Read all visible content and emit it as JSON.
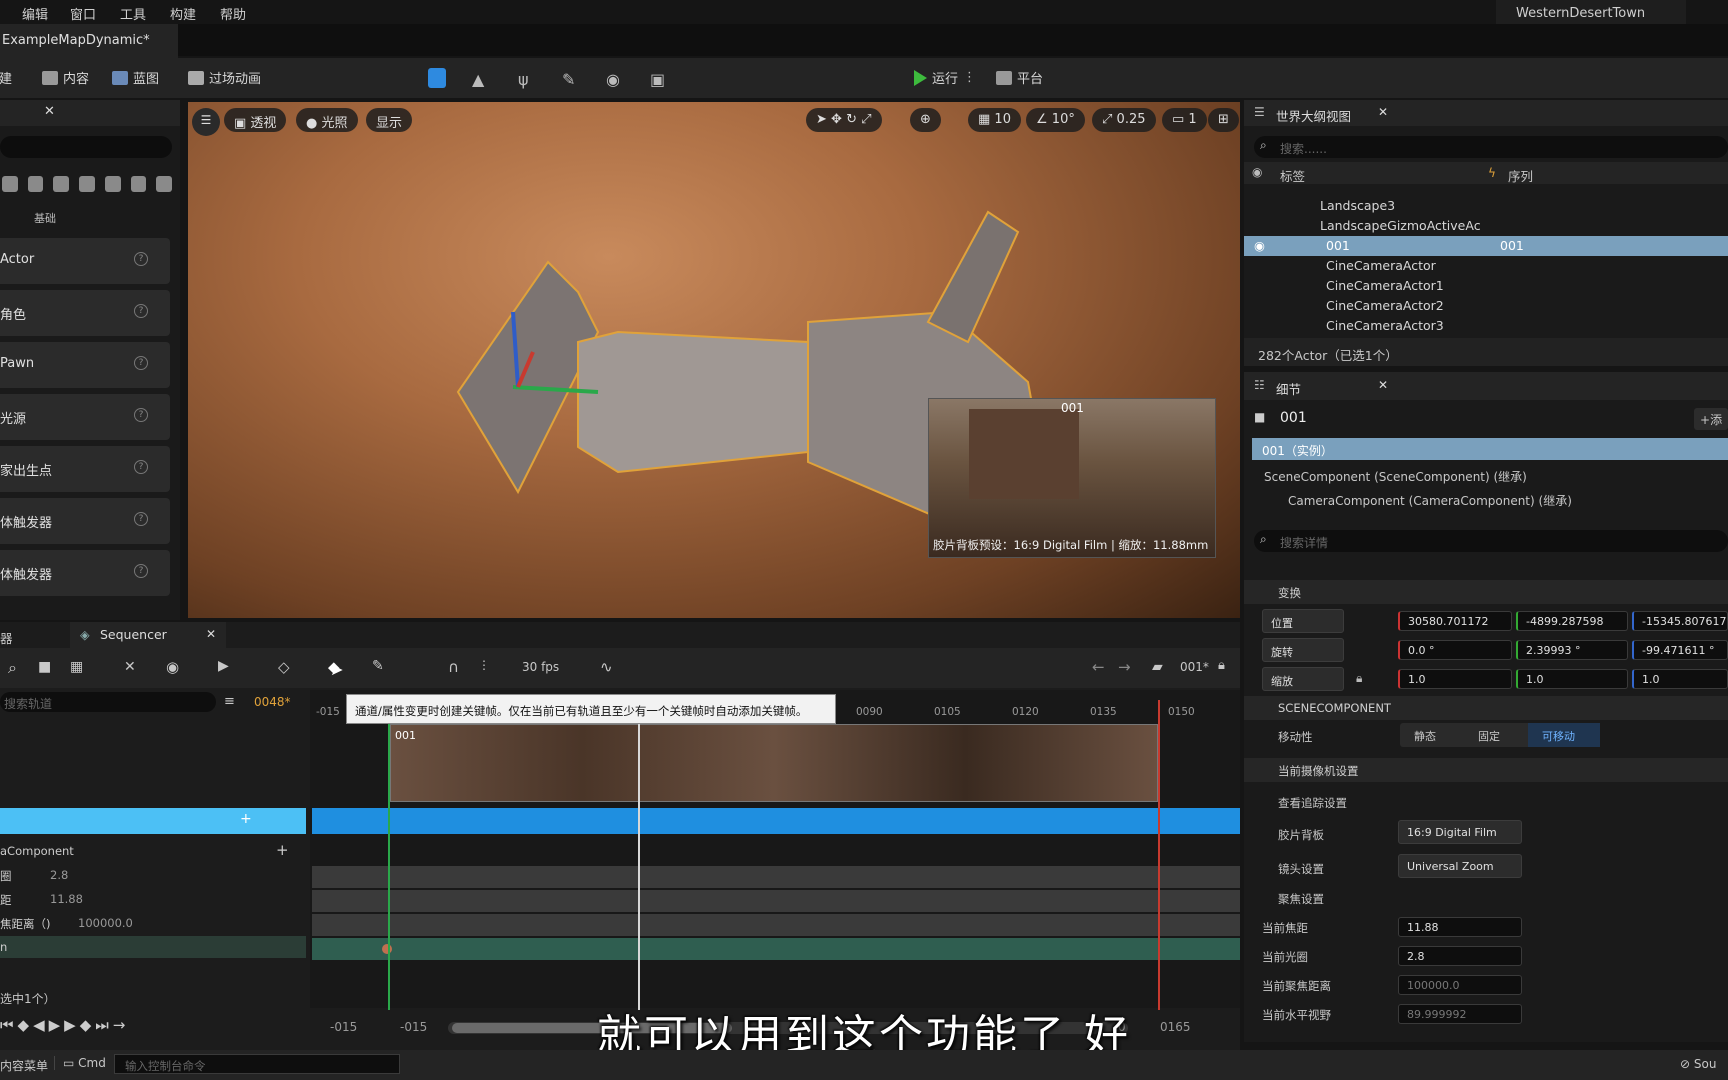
{
  "menubar": {
    "items": [
      "编辑",
      "窗口",
      "工具",
      "构建",
      "帮助"
    ],
    "project": "WesternDesertTown"
  },
  "map_tab": "ExampleMapDynamic*",
  "toolbar": {
    "create": "创建",
    "content": "内容",
    "blueprint": "蓝图",
    "cinematics": "过场动画",
    "run": "运行",
    "platform": "平台"
  },
  "place_panel": {
    "category": "基础",
    "items": [
      "Actor",
      "角色",
      "Pawn",
      "光源",
      "家出生点",
      "体触发器",
      "体触发器"
    ]
  },
  "viewport": {
    "perspective": "透视",
    "lit": "光照",
    "show": "显示",
    "grid": "10",
    "angle": "10°",
    "scale": "0.25",
    "cam": "1",
    "pip_label": "001",
    "pip_info": "胶片背板预设：16:9 Digital Film | 缩放：11.88mm"
  },
  "outliner": {
    "title": "世界大纲视图",
    "search_placeholder": "搜索......",
    "col_label": "标签",
    "col_seq": "序列",
    "rows": [
      {
        "name": "Landscape3",
        "seq": ""
      },
      {
        "name": "LandscapeGizmoActiveAc",
        "seq": ""
      },
      {
        "name": "001",
        "seq": "001"
      },
      {
        "name": "CineCameraActor",
        "seq": ""
      },
      {
        "name": "CineCameraActor1",
        "seq": ""
      },
      {
        "name": "CineCameraActor2",
        "seq": ""
      },
      {
        "name": "CineCameraActor3",
        "seq": ""
      }
    ],
    "count": "282个Actor（已选1个）"
  },
  "details": {
    "title": "细节",
    "actor": "001",
    "add": "添",
    "instance": "001（实例）",
    "scene_component": "SceneComponent (SceneComponent) (继承)",
    "camera_component": "CameraComponent (CameraComponent) (继承)",
    "search_placeholder": "搜索详情",
    "transform": "变换",
    "location_label": "位置",
    "location": [
      "30580.701172",
      "-4899.287598",
      "-15345.807617"
    ],
    "rotation_label": "旋转",
    "rotation": [
      "0.0 °",
      "2.39993 °",
      "-99.471611 °"
    ],
    "scale_label": "缩放",
    "scale": [
      "1.0",
      "1.0",
      "1.0"
    ],
    "scenecomponent": "SCENECOMPONENT",
    "mobility_label": "移动性",
    "mobility": [
      "静态",
      "固定",
      "可移动"
    ],
    "camera_settings": "当前摄像机设置",
    "lookat": "查看追踪设置",
    "filmback_label": "胶片背板",
    "filmback": "16:9 Digital Film",
    "lens_label": "镜头设置",
    "lens": "Universal Zoom",
    "focus_label": "聚焦设置",
    "focal_label": "当前焦距",
    "focal": "11.88",
    "aperture_label": "当前光圈",
    "aperture": "2.8",
    "focus_dist_label": "当前聚焦距离",
    "focus_dist": "100000.0",
    "hfov_label": "当前水平视野",
    "hfov": "89.999992"
  },
  "sequencer": {
    "prev_tab": "器",
    "tab": "Sequencer",
    "fps": "30 fps",
    "seq_name": "001*",
    "search_placeholder": "搜索轨道",
    "frame": "0048*",
    "ticks": [
      "-015",
      "0090",
      "0105",
      "0120",
      "0135",
      "0150"
    ],
    "track_component": "aComponent",
    "tracks": [
      {
        "label": "圈",
        "value": "2.8"
      },
      {
        "label": "距",
        "value": "11.88"
      },
      {
        "label": "焦距离（)",
        "value": "100000.0"
      },
      {
        "label": "n",
        "value": ""
      }
    ],
    "clip_label": "001",
    "selected": "选中1个）",
    "range_start": "-015",
    "range_start2": "-015",
    "range_end": "0165",
    "range_mid": "0",
    "tooltip": "通道/属性变更时创建关键帧。仅在当前已有轨道且至少有一个关键帧时自动添加关键帧。"
  },
  "subtitle": "就可以用到这个功能了 好",
  "statusbar": {
    "menu": "内容菜单",
    "cmd": "Cmd",
    "console_placeholder": "输入控制台命令",
    "source": "Sou"
  }
}
